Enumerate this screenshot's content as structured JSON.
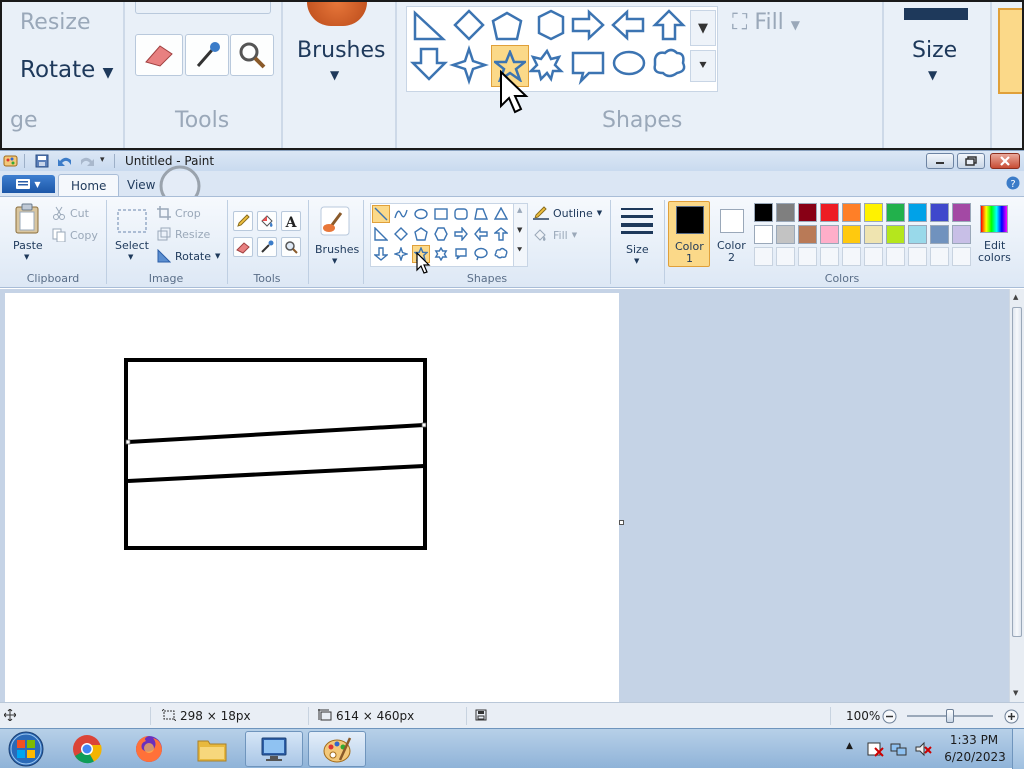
{
  "window": {
    "title": "Untitled - Paint"
  },
  "menu": {
    "tabs": [
      "Home",
      "View"
    ]
  },
  "zoom_view": {
    "resize": "Resize",
    "rotate": "Rotate",
    "brushes": "Brushes",
    "fill": "Fill",
    "size": "Size",
    "group_tools": "Tools",
    "group_shapes": "Shapes",
    "group_image_tail": "ge"
  },
  "ribbon": {
    "clipboard": {
      "paste": "Paste",
      "cut": "Cut",
      "copy": "Copy",
      "label": "Clipboard"
    },
    "image": {
      "select": "Select",
      "crop": "Crop",
      "resize": "Resize",
      "rotate": "Rotate",
      "label": "Image"
    },
    "tools": {
      "label": "Tools"
    },
    "brushes": {
      "label": "Brushes"
    },
    "shapes": {
      "outline": "Outline",
      "fill": "Fill",
      "label": "Shapes"
    },
    "size": {
      "label": "Size"
    },
    "colors": {
      "color1": "Color",
      "color1_num": "1",
      "color2": "Color",
      "color2_num": "2",
      "edit1": "Edit",
      "edit2": "colors",
      "label": "Colors"
    }
  },
  "palette": {
    "row1": [
      "#000000",
      "#7f7f7f",
      "#880015",
      "#ed1c24",
      "#ff7f27",
      "#fff200",
      "#22b14c",
      "#00a2e8",
      "#3f48cc",
      "#a349a4"
    ],
    "row2": [
      "#ffffff",
      "#c3c3c3",
      "#b97a57",
      "#ffaec9",
      "#ffc90e",
      "#efe4b0",
      "#b5e61d",
      "#99d9ea",
      "#7092be",
      "#c8bfe7"
    ]
  },
  "status": {
    "selection_size": "298 × 18px",
    "canvas_size": "614 × 460px",
    "zoom": "100%"
  },
  "taskbar": {
    "time": "1:33 PM",
    "date": "6/20/2023"
  },
  "icons": [
    "paint-app-icon",
    "save-icon",
    "undo-icon",
    "redo-icon",
    "star-shape-icon",
    "pencil-icon",
    "fill-bucket-icon",
    "text-icon",
    "eraser-icon",
    "color-picker-icon",
    "magnifier-icon",
    "chrome-icon",
    "firefox-icon",
    "folder-icon",
    "network-icon",
    "paint-icon"
  ]
}
